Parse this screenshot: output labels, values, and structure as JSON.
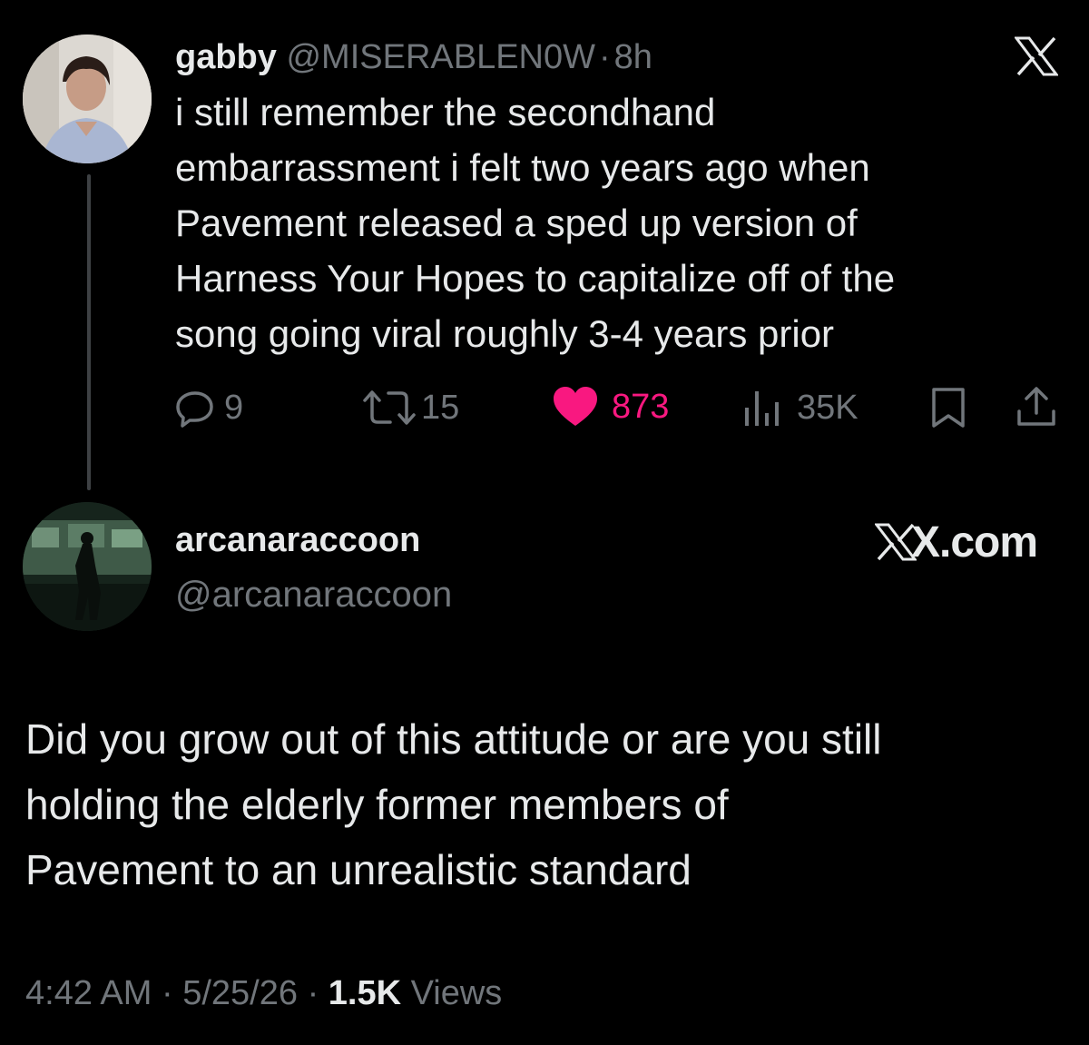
{
  "quoted_tweet": {
    "display_name": "gabby",
    "handle": "@MISERABLEN0W",
    "separator": "·",
    "time_ago": "8h",
    "text_lines": [
      "i still remember the secondhand",
      "embarrassment i felt two years ago when",
      "Pavement released a sped up version of",
      "Harness Your Hopes to capitalize off of the",
      "song going viral roughly 3-4 years prior"
    ],
    "replies": "9",
    "reposts": "15",
    "likes": "873",
    "views": "35K",
    "x_logo_icon": "x-logo-icon"
  },
  "reply_tweet": {
    "display_name": "arcanaraccoon",
    "handle": "@arcanaraccoon",
    "site_label": "X.com",
    "text_lines": [
      "Did you grow out of this attitude or are you still",
      "holding the elderly former members of",
      "Pavement to an unrealistic standard"
    ],
    "timestamp_time": "4:42 AM",
    "timestamp_date": "5/25/26",
    "separator": "·",
    "views_count": "1.5K",
    "views_label": "Views"
  },
  "colors": {
    "background": "#000000",
    "text": "#e7e9ea",
    "muted": "#71767b",
    "like": "#f91880",
    "thread_line": "#3e4144"
  }
}
